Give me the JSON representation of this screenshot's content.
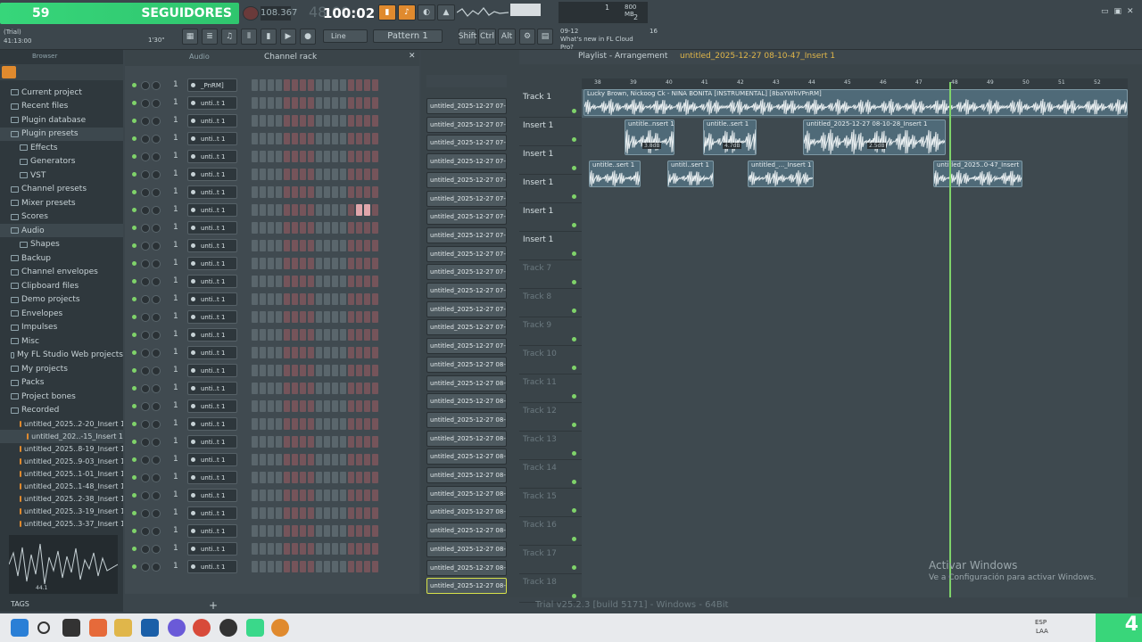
{
  "overlay": {
    "count": "59",
    "label": "SEGUIDORES"
  },
  "transport": {
    "tempo": "108.367",
    "time": "48:00",
    "bar_readout": "100:02",
    "mode_label": "Line",
    "pattern": "Pattern 1",
    "keys": [
      "Shift",
      "Ctrl",
      "Alt"
    ],
    "news_time": "09-12",
    "news_text": "What's new in FL Cloud Pro?",
    "hint_num": "16"
  },
  "cpu": {
    "value": "1",
    "mem": "800 MB",
    "sub": "2"
  },
  "hint": {
    "trial": "(Trial)",
    "position": "41:13:00",
    "length": "1'30\""
  },
  "browser": {
    "title": "Browser",
    "items": [
      {
        "label": "Current project"
      },
      {
        "label": "Recent files"
      },
      {
        "label": "Plugin database"
      },
      {
        "label": "Plugin presets"
      },
      {
        "label": "Effects"
      },
      {
        "label": "Generators"
      },
      {
        "label": "VST"
      },
      {
        "label": "Channel presets"
      },
      {
        "label": "Mixer presets"
      },
      {
        "label": "Scores"
      },
      {
        "label": "Audio"
      },
      {
        "label": "Shapes"
      },
      {
        "label": "Backup"
      },
      {
        "label": "Channel envelopes"
      },
      {
        "label": "Clipboard files"
      },
      {
        "label": "Demo projects"
      },
      {
        "label": "Envelopes"
      },
      {
        "label": "Impulses"
      },
      {
        "label": "Misc"
      },
      {
        "label": "My FL Studio Web projects"
      },
      {
        "label": "My projects"
      },
      {
        "label": "Packs"
      },
      {
        "label": "Project bones"
      },
      {
        "label": "Recorded"
      }
    ],
    "recorded": [
      {
        "label": "untitled_2025..2-20_Insert 1"
      },
      {
        "label": "untitled_202..-15_Insert 1"
      },
      {
        "label": "untitled_2025..8-19_Insert 1"
      },
      {
        "label": "untitled_2025..9-03_Insert 1"
      },
      {
        "label": "untitled_2025..1-01_Insert 1"
      },
      {
        "label": "untitled_2025..1-48_Insert 1"
      },
      {
        "label": "untitled_2025..2-38_Insert 1"
      },
      {
        "label": "untitled_2025..3-19_Insert 1"
      },
      {
        "label": "untitled_2025..3-37_Insert 1"
      }
    ],
    "preview_info": "44.1",
    "tags": "TAGS"
  },
  "rack": {
    "title": "Channel rack",
    "group": "Audio",
    "channels": [
      {
        "name": "_PnRM]",
        "num": "1"
      },
      {
        "name": "unti..t 1",
        "num": "1"
      },
      {
        "name": "unti..t 1",
        "num": "1"
      },
      {
        "name": "unti..t 1",
        "num": "1"
      },
      {
        "name": "unti..t 1",
        "num": "1"
      },
      {
        "name": "unti..t 1",
        "num": "1"
      },
      {
        "name": "unti..t 1",
        "num": "1"
      },
      {
        "name": "unti..t 1",
        "num": "1"
      },
      {
        "name": "unti..t 1",
        "num": "1"
      },
      {
        "name": "unti..t 1",
        "num": "1"
      },
      {
        "name": "unti..t 1",
        "num": "1"
      },
      {
        "name": "unti..t 1",
        "num": "1"
      },
      {
        "name": "unti..t 1",
        "num": "1"
      },
      {
        "name": "unti..t 1",
        "num": "1"
      },
      {
        "name": "unti..t 1",
        "num": "1"
      },
      {
        "name": "unti..t 1",
        "num": "1"
      },
      {
        "name": "unti..t 1",
        "num": "1"
      },
      {
        "name": "unti..t 1",
        "num": "1"
      },
      {
        "name": "unti..t 1",
        "num": "1"
      },
      {
        "name": "unti..t 1",
        "num": "1"
      },
      {
        "name": "unti..t 1",
        "num": "1"
      },
      {
        "name": "unti..t 1",
        "num": "1"
      },
      {
        "name": "unti..t 1",
        "num": "1"
      },
      {
        "name": "unti..t 1",
        "num": "1"
      },
      {
        "name": "unti..t 1",
        "num": "1"
      },
      {
        "name": "unti..t 1",
        "num": "1"
      },
      {
        "name": "unti..t 1",
        "num": "1"
      },
      {
        "name": "unti..t 1",
        "num": "1"
      }
    ]
  },
  "mixlist": [
    "untitled_2025-12-27 07-",
    "untitled_2025-12-27 07-",
    "untitled_2025-12-27 07-",
    "untitled_2025-12-27 07-",
    "untitled_2025-12-27 07-",
    "untitled_2025-12-27 07-",
    "untitled_2025-12-27 07-",
    "untitled_2025-12-27 07-",
    "untitled_2025-12-27 07-",
    "untitled_2025-12-27 07-",
    "untitled_2025-12-27 07-",
    "untitled_2025-12-27 07-",
    "untitled_2025-12-27 07-",
    "untitled_2025-12-27 07-",
    "untitled_2025-12-27 08-",
    "untitled_2025-12-27 08-",
    "untitled_2025-12-27 08-",
    "untitled_2025-12-27 08-",
    "untitled_2025-12-27 08-",
    "untitled_2025-12-27 08-",
    "untitled_2025-12-27 08-",
    "untitled_2025-12-27 08-",
    "untitled_2025-12-27 08-",
    "untitled_2025-12-27 08-",
    "untitled_2025-12-27 08-",
    "untitled_2025-12-27 08-",
    "untitled_2025-12-27 08-"
  ],
  "playlist": {
    "title": "Playlist - Arrangement",
    "breadcrumb": "untitled_2025-12-27 08-10-47_Insert 1",
    "ruler": [
      "38",
      "39",
      "40",
      "41",
      "42",
      "43",
      "44",
      "45",
      "46",
      "47",
      "48",
      "49",
      "50",
      "51",
      "52"
    ],
    "tracks": [
      {
        "label": "Track 1"
      },
      {
        "label": "Insert 1"
      },
      {
        "label": "Insert 1"
      },
      {
        "label": "Insert 1"
      },
      {
        "label": "Insert 1"
      },
      {
        "label": "Insert 1"
      },
      {
        "label": "Track 7"
      },
      {
        "label": "Track 8"
      },
      {
        "label": "Track 9"
      },
      {
        "label": "Track 10"
      },
      {
        "label": "Track 11"
      },
      {
        "label": "Track 12"
      },
      {
        "label": "Track 13"
      },
      {
        "label": "Track 14"
      },
      {
        "label": "Track 15"
      },
      {
        "label": "Track 16"
      },
      {
        "label": "Track 17"
      },
      {
        "label": "Track 18"
      }
    ],
    "clips": [
      {
        "label": "Lucky Brown, Nickoog Ck - NINA BONITA [INSTRUMENTAL] [8baYWhVPnRM]"
      },
      {
        "label": "untitle..nsert 1"
      },
      {
        "label": "untitle..sert 1"
      },
      {
        "label": "untitled_2025-12-27 08-10-28_Insert 1"
      },
      {
        "label": "untitle..sert 1"
      },
      {
        "label": "untitl..sert 1"
      },
      {
        "label": "untitled_..._Insert 1"
      },
      {
        "label": "untitled_2025..0-47_Insert 1"
      }
    ],
    "gain_badges": [
      "3.8dB",
      "4.7dB",
      "2.5dB"
    ]
  },
  "watermark": {
    "line1": "Activar Windows",
    "line2": "Ve a Configuración para activar Windows."
  },
  "version": "Trial v25.2.3 [build 5171] - Windows - 64Bit",
  "taskbar": {
    "lang": "ESP",
    "region": "LAA"
  },
  "colors": {
    "accent_green": "#37d67a",
    "playhead": "#7fd36a",
    "clip": "#4f6a78"
  }
}
